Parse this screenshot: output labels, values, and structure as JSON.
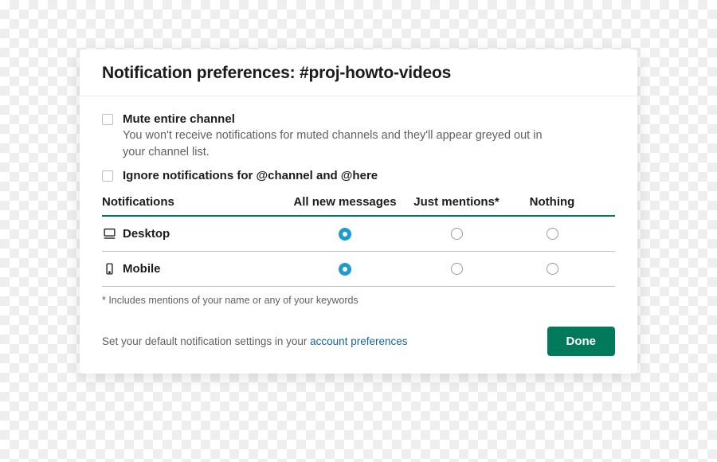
{
  "header": {
    "title": "Notification preferences: #proj-howto-videos"
  },
  "mute": {
    "label": "Mute entire channel",
    "desc": "You won't receive notifications for muted channels and they'll appear greyed out in your channel list."
  },
  "ignore": {
    "label": "Ignore notifications for @channel and @here"
  },
  "table": {
    "heading": "Notifications",
    "col1": "All new messages",
    "col2": "Just mentions*",
    "col3": "Nothing",
    "rows": [
      {
        "label": "Desktop",
        "selected": 0
      },
      {
        "label": "Mobile",
        "selected": 0
      }
    ]
  },
  "footnote": "* Includes mentions of your name or any of your keywords",
  "footer": {
    "prefix": "Set your default notification settings in your ",
    "link": "account preferences"
  },
  "done": "Done"
}
